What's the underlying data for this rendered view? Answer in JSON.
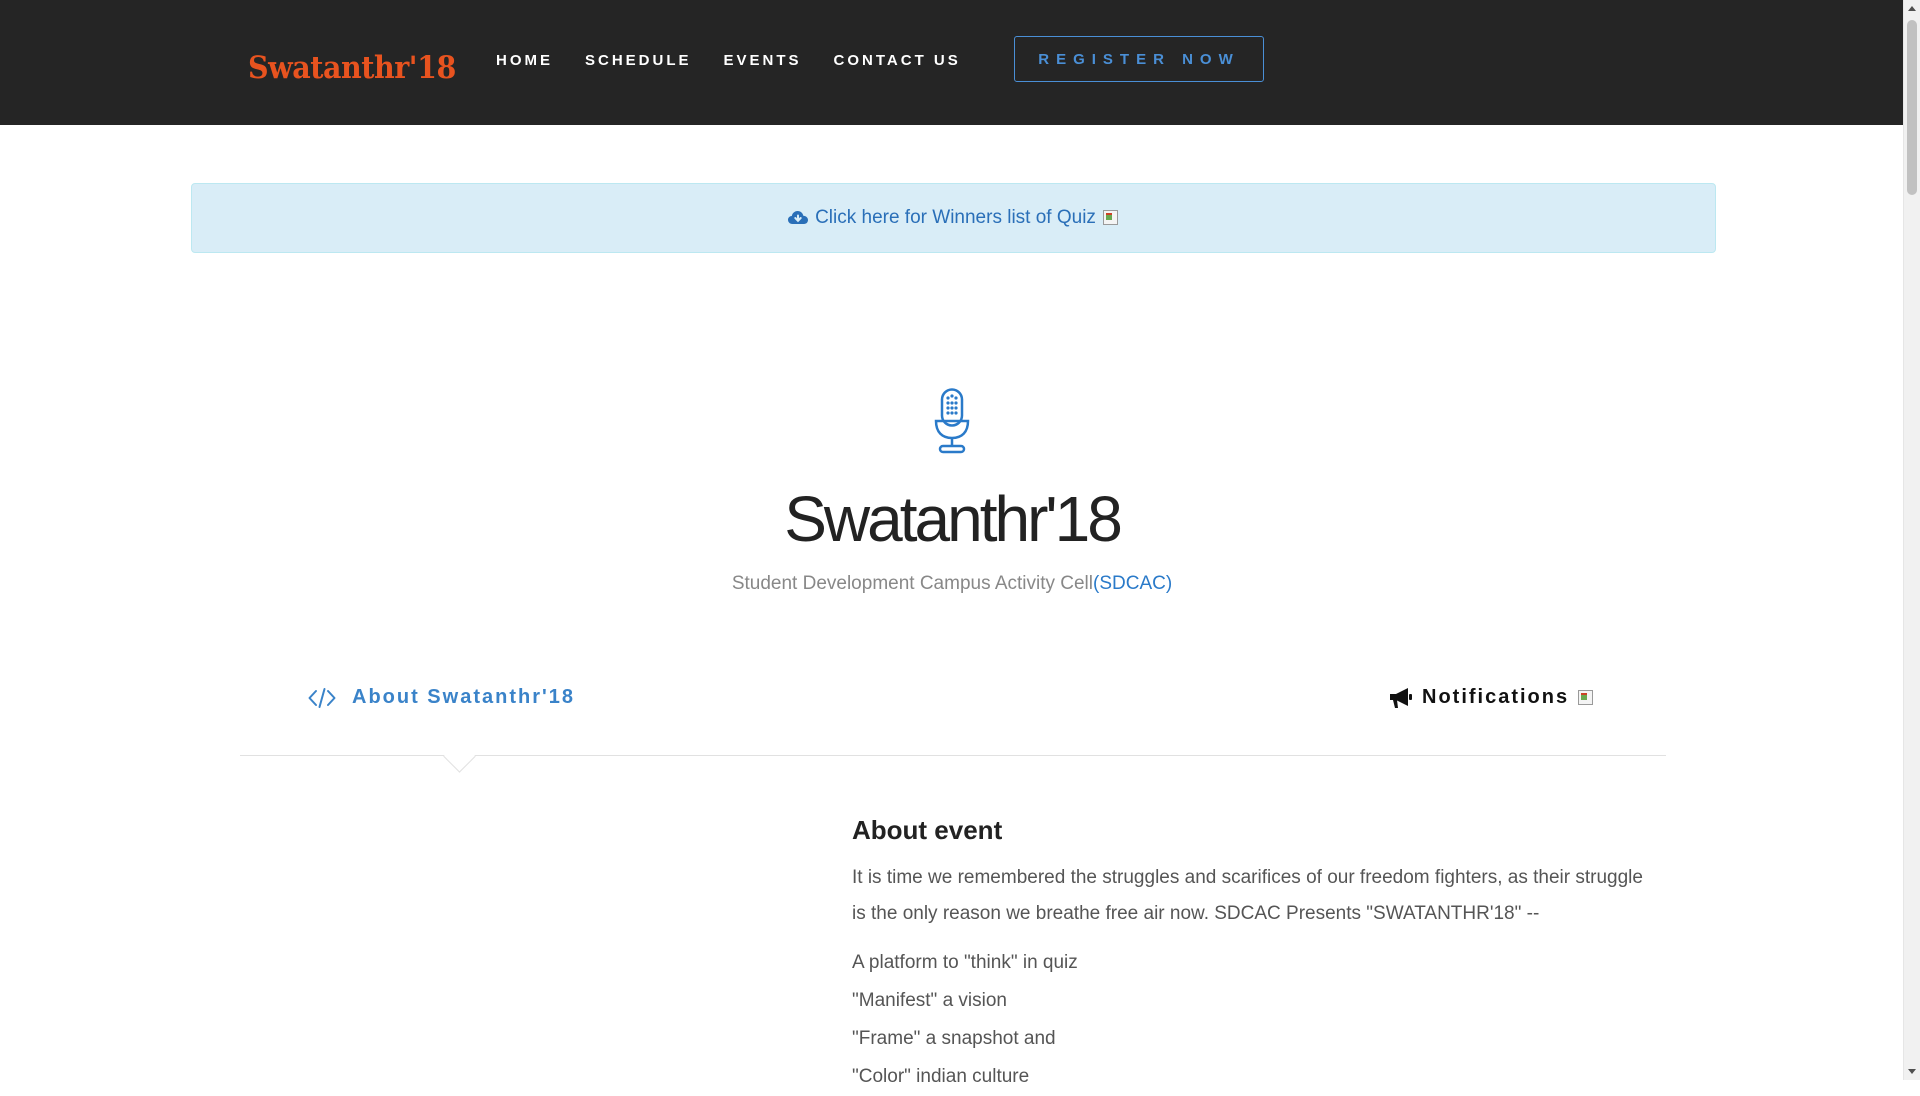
{
  "brand": {
    "logo_text": "Swatanthr'18",
    "logo_color": "#e8531f",
    "accent": "#3a83c9"
  },
  "nav": {
    "items": [
      {
        "label": "HOME"
      },
      {
        "label": "SCHEDULE"
      },
      {
        "label": "EVENTS"
      },
      {
        "label": "CONTACT US"
      }
    ],
    "register_label": "REGISTER NOW"
  },
  "alert": {
    "icon": "cloud-download-icon",
    "text": "Click here for Winners list of Quiz"
  },
  "hero": {
    "icon": "microphone-icon",
    "title": "Swatanthr'18",
    "subtitle": "Student Development Campus Activity Cell",
    "subtitle_acronym": "(SDCAC)"
  },
  "tabs": {
    "about": {
      "icon": "code-icon",
      "label": "About Swatanthr'18"
    },
    "notifications": {
      "icon": "bullhorn-icon",
      "label": "Notifications"
    }
  },
  "content": {
    "heading": "About event",
    "intro": "It is time we remembered the struggles and scarifices of our freedom fighters, as their struggle is the only reason we breathe free air now. SDCAC Presents \"SWATANTHR'18\" --",
    "lines": [
      "A platform to \"think\" in quiz",
      "\"Manifest\" a vision",
      "\"Frame\" a snapshot and",
      "\"Color\" indian culture"
    ]
  }
}
